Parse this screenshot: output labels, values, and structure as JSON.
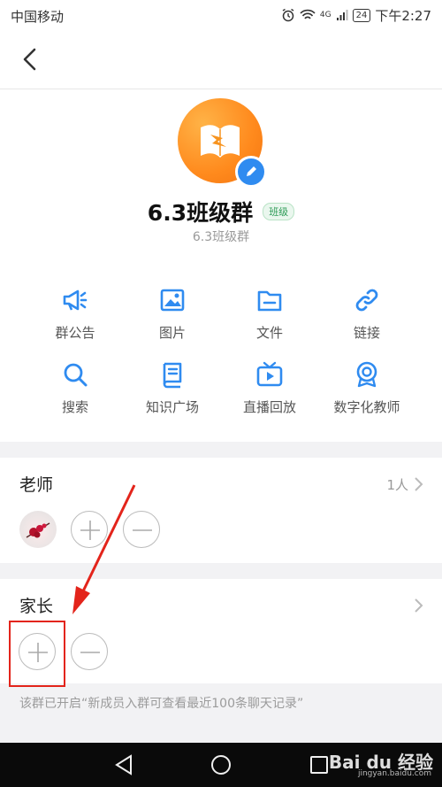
{
  "status_bar": {
    "carrier": "中国移动",
    "battery": "24",
    "network": "4G",
    "time": "下午2:27"
  },
  "group": {
    "name": "6.3班级群",
    "tag": "班级",
    "subtitle": "6.3班级群"
  },
  "features": [
    {
      "label": "群公告",
      "icon": "megaphone-icon"
    },
    {
      "label": "图片",
      "icon": "image-icon"
    },
    {
      "label": "文件",
      "icon": "folder-icon"
    },
    {
      "label": "链接",
      "icon": "link-icon"
    },
    {
      "label": "搜索",
      "icon": "search-icon"
    },
    {
      "label": "知识广场",
      "icon": "book-icon"
    },
    {
      "label": "直播回放",
      "icon": "tv-icon"
    },
    {
      "label": "数字化教师",
      "icon": "badge-icon"
    }
  ],
  "teachers": {
    "title": "老师",
    "count": "1人"
  },
  "parents": {
    "title": "家长"
  },
  "hint": "该群已开启“新成员入群可查看最近100条聊天记录”",
  "watermark": {
    "brand": "Bai du 经验",
    "site": "jingyan.baidu.com"
  },
  "colors": {
    "accent": "#2f8bf0",
    "annotation": "#e3241b",
    "avatar": "#f7931e",
    "tag": "#2e9b57"
  }
}
